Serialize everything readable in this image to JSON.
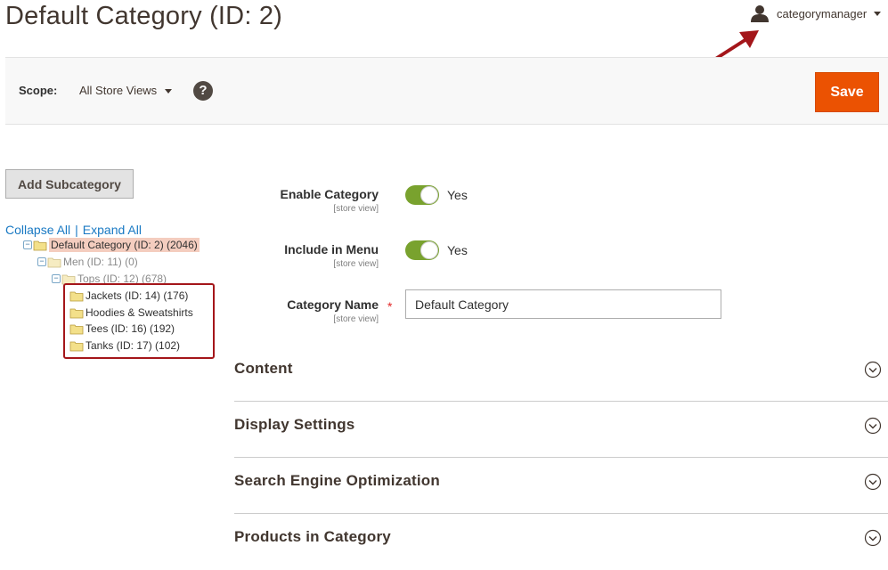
{
  "header": {
    "title": "Default Category (ID: 2)",
    "user_name": "categorymanager"
  },
  "toolbar": {
    "scope_label": "Scope:",
    "scope_value": "All Store Views",
    "help": "?",
    "save_label": "Save"
  },
  "tree": {
    "add_button": "Add Subcategory",
    "collapse_all": "Collapse All",
    "separator": "|",
    "expand_all": "Expand All",
    "nodes": [
      {
        "label": "Default Category (ID: 2) (2046)"
      },
      {
        "label": "Men (ID: 11) (0)"
      },
      {
        "label": "Tops (ID: 12) (678)"
      },
      {
        "label": "Jackets (ID: 14) (176)"
      },
      {
        "label": "Hoodies & Sweatshirts"
      },
      {
        "label": "Tees (ID: 16) (192)"
      },
      {
        "label": "Tanks (ID: 17) (102)"
      }
    ]
  },
  "form": {
    "enable_category": {
      "label": "Enable Category",
      "scope": "[store view]",
      "value": "Yes",
      "enabled": true
    },
    "include_in_menu": {
      "label": "Include in Menu",
      "scope": "[store view]",
      "value": "Yes",
      "enabled": true
    },
    "category_name": {
      "label": "Category Name",
      "scope": "[store view]",
      "value": "Default Category",
      "required": "*"
    }
  },
  "sections": [
    {
      "title": "Content"
    },
    {
      "title": "Display Settings"
    },
    {
      "title": "Search Engine Optimization"
    },
    {
      "title": "Products in Category"
    }
  ],
  "colors": {
    "accent": "#eb5202",
    "toggle_on": "#79a22e",
    "link": "#1979c3",
    "annotation": "#a4161a"
  },
  "icons": [
    "user-icon",
    "caret-down-icon",
    "help-icon",
    "folder-icon",
    "chevron-down-circle-icon",
    "annotation-arrow"
  ]
}
